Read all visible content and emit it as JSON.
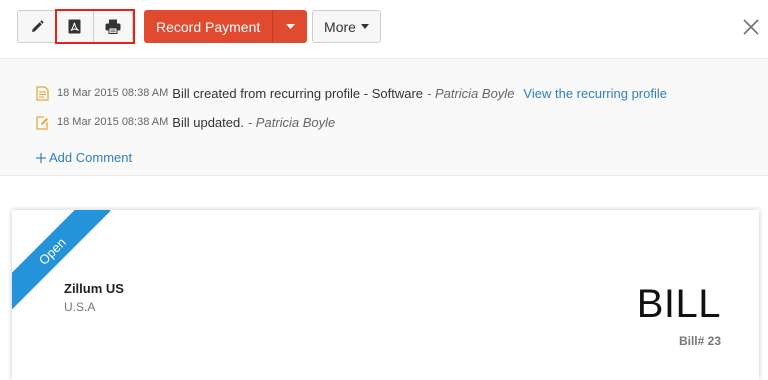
{
  "toolbar": {
    "edit_icon": "pencil-icon",
    "pdf_icon": "pdf-icon",
    "print_icon": "printer-icon",
    "record_payment_label": "Record Payment",
    "more_label": "More",
    "close_icon": "close-icon"
  },
  "activity": {
    "entries": [
      {
        "icon": "document-icon",
        "time": "18 Mar 2015 08:38 AM",
        "message": "Bill created from recurring profile - Software",
        "user": "- Patricia Boyle",
        "link": "View the recurring profile"
      },
      {
        "icon": "edit-document-icon",
        "time": "18 Mar 2015 08:38 AM",
        "message": "Bill updated.",
        "user": "- Patricia Boyle"
      }
    ],
    "add_comment_label": "Add Comment"
  },
  "document": {
    "status": "Open",
    "organization_name": "Zillum US",
    "organization_country": "U.S.A",
    "title": "BILL",
    "number": "Bill# 23"
  },
  "colors": {
    "primary_button": "#e04a2f",
    "link": "#2f7fc1",
    "ribbon": "#2593d9",
    "highlight": "#e2231a",
    "activity_icon": "#e8a93a"
  }
}
